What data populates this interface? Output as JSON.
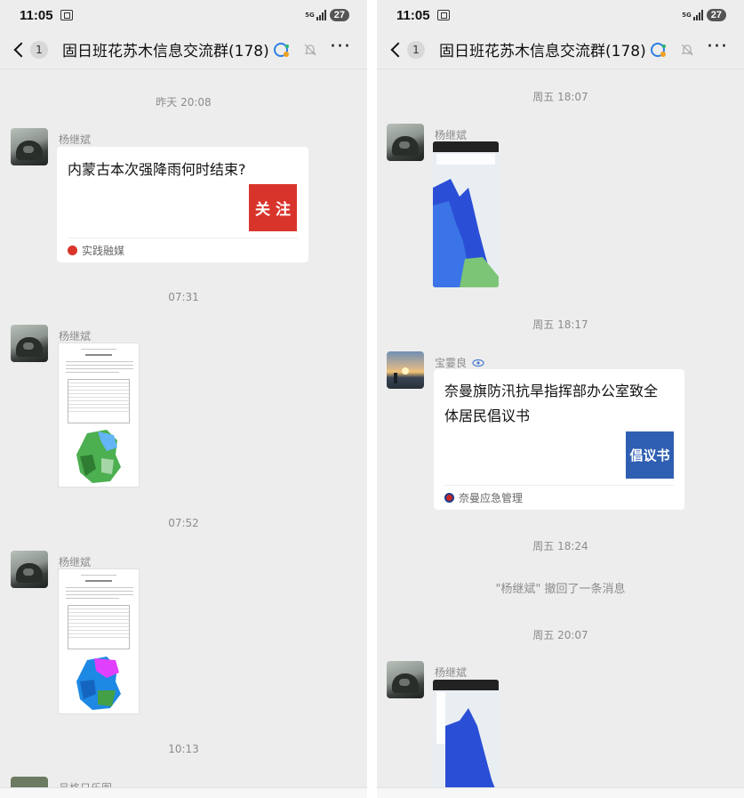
{
  "status_bar": {
    "time": "11:05",
    "network": "5G",
    "battery": "27"
  },
  "nav": {
    "unread_count": "1",
    "title": "固日班花苏木信息交流群(178)",
    "more_label": "···"
  },
  "left_chat": {
    "timestamps": [
      "昨天 20:08",
      "07:31",
      "07:52",
      "10:13"
    ],
    "messages": [
      {
        "sender": "杨继斌",
        "card_title": "内蒙古本次强降雨何时结束?",
        "card_thumb_text": "关 注",
        "card_source": "实践融媒"
      },
      {
        "sender": "杨继斌"
      },
      {
        "sender": "杨继斌"
      },
      {
        "sender": "吕格日乐图"
      }
    ]
  },
  "right_chat": {
    "timestamps": [
      "周五 18:07",
      "周五 18:17",
      "周五 18:24",
      "周五 20:07"
    ],
    "messages": [
      {
        "sender": "杨继斌"
      },
      {
        "sender": "宝霎良",
        "card_title_line1": "奈曼旗防汛抗旱指挥部办公室致全",
        "card_title_line2": "体居民倡议书",
        "card_thumb_text": "倡议书",
        "card_source": "奈曼应急管理"
      },
      {
        "sender": "杨继斌"
      }
    ],
    "system_message": "\"杨继斌\" 撤回了一条消息"
  },
  "colors": {
    "background": "#ededed",
    "card": "#ffffff",
    "meta_text": "#8c8c8c",
    "red_thumb": "#d9342b",
    "blue_thumb": "#2f5fb3"
  }
}
